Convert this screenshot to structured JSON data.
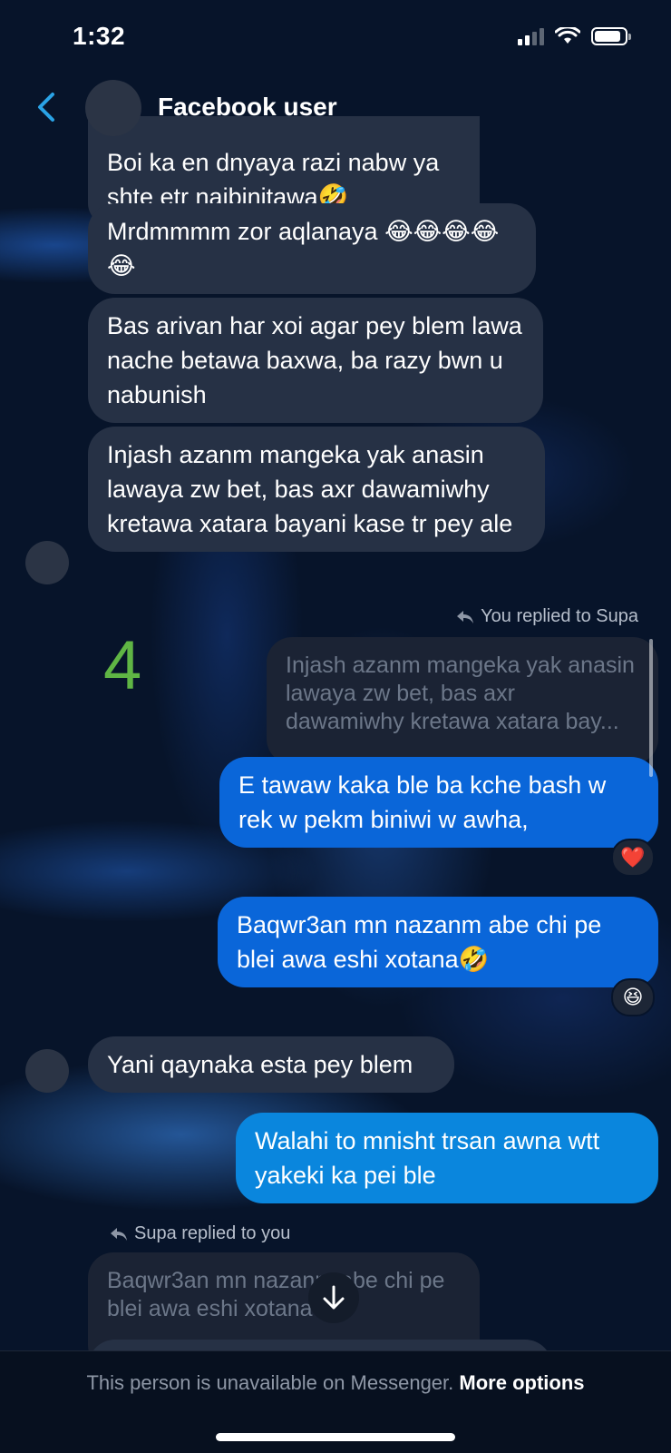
{
  "status_bar": {
    "time": "1:32"
  },
  "header": {
    "name": "Facebook user"
  },
  "messages": {
    "m0": "Boi ka en dnyaya razi nabw ya shte etr naibinitawa🤣",
    "m1": "Mrdmmmm zor aqlanaya 😂😂😂😂😂",
    "m2": "Bas arivan har xoi agar pey blem lawa nache betawa baxwa, ba razy bwn u nabunish",
    "m3": "Injash azanm mangeka yak anasin lawaya zw bet, bas axr dawamiwhy kretawa xatara bayani kase tr pey ale",
    "reply_note_1": "You replied to Supa",
    "quote_1": "Injash azanm mangeka yak anasin lawaya zw bet, bas axr dawamiwhy kretawa xatara bay...",
    "m4": "E tawaw kaka ble ba kche bash w rek w pekm biniwi w awha,",
    "m4_reaction": "❤️",
    "m5": "Baqwr3an mn nazanm abe chi pe blei awa eshi xotana🤣",
    "m5_reaction": "😆",
    "m6": "Yani qaynaka esta pey blem",
    "m7": "Walahi to mnisht trsan awna wtt yakeki ka pei ble",
    "reply_note_2": "Supa replied to you",
    "quote_2": "Baqwr3an mn nazanm abe chi pe blei awa eshi xotana🤣"
  },
  "overlay_number": "4",
  "footer": {
    "unavailable_text": "This person is unavailable on Messenger.",
    "more_options": "More options"
  }
}
